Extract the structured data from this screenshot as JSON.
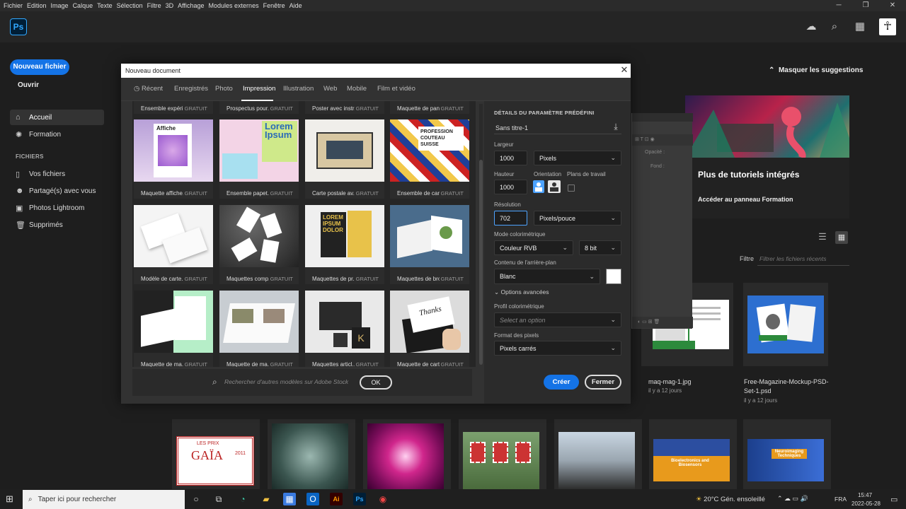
{
  "menubar": {
    "items": [
      "Fichier",
      "Edition",
      "Image",
      "Calque",
      "Texte",
      "Sélection",
      "Filtre",
      "3D",
      "Affichage",
      "Modules externes",
      "Fenêtre",
      "Aide"
    ]
  },
  "app": {
    "logo": "Ps"
  },
  "sidebar": {
    "new_file": "Nouveau fichier",
    "open": "Ouvrir",
    "home": "Accueil",
    "learn": "Formation",
    "files_title": "FICHIERS",
    "your_files": "Vos fichiers",
    "shared": "Partagé(s) avec vous",
    "lightroom": "Photos Lightroom",
    "deleted": "Supprimés"
  },
  "home": {
    "hide_suggestions": "Masquer les suggestions",
    "tutorial_title": "Plus de tutoriels intégrés",
    "tutorial_link": "Accéder au panneau Formation",
    "filter_label": "Filtre",
    "filter_placeholder": "Filtrer les fichiers récents",
    "recent": [
      {
        "name": "maq-mag-1.jpg",
        "date": "il y a 12 jours"
      },
      {
        "name": "Free-Magazine-Mockup-PSD-",
        "name2": "Set-1.psd",
        "date": "il y a 12 jours"
      }
    ],
    "bottom_gaia": {
      "line1": "LES PRIX",
      "line2": "GAÏA",
      "line3": "2011"
    },
    "bottom_bio": "Bioelectronics and Biosensors",
    "bottom_neuro": "Neuroimaging Techniques"
  },
  "dialog": {
    "title": "Nouveau document",
    "tabs": [
      "Récent",
      "Enregistrés",
      "Photo",
      "Impression",
      "Illustration",
      "Web",
      "Mobile",
      "Film et vidéo"
    ],
    "active_tab": "Impression",
    "free_label": "GRATUIT",
    "templates_top": [
      "Ensemble expéri...",
      "Prospectus pour...",
      "Poster avec instr...",
      "Maquette de pan..."
    ],
    "templates": [
      "Maquette affiche...",
      "Ensemble papet...",
      "Carte postale av...",
      "Ensemble de car...",
      "Modèle de carte...",
      "Maquettes comp...",
      "Maquettes de pr...",
      "Maquettes de bro...",
      "Maquette de ma...",
      "Maquette de ma...",
      "Maquettes articl...",
      "Maquette de cart..."
    ],
    "thumb_texts": {
      "affiche": "Affiche",
      "lorem": "Lorem Ipsum",
      "pro": "PROFESSION COUTEAU SUISSE",
      "lorem_dolor": "LOREM IPSUM DOLOR",
      "thanks": "Thanks"
    },
    "search_placeholder": "Rechercher d'autres modèles sur Adobe Stock",
    "ok": "OK",
    "preset": {
      "title": "DÉTAILS DU PARAMÈTRE PRÉDÉFINI",
      "name": "Sans titre-1",
      "width_label": "Largeur",
      "width_value": "1000",
      "width_unit": "Pixels",
      "height_label": "Hauteur",
      "height_value": "1000",
      "orientation_label": "Orientation",
      "artboards_label": "Plans de travail",
      "resolution_label": "Résolution",
      "resolution_value": "702",
      "resolution_unit": "Pixels/pouce",
      "color_mode_label": "Mode colorimétrique",
      "color_mode": "Couleur RVB",
      "bit_depth": "8 bit",
      "bg_label": "Contenu de l'arrière-plan",
      "bg_value": "Blanc",
      "advanced": "Options avancées",
      "profile_label": "Profil colorimétrique",
      "profile_placeholder": "Select an option",
      "pixel_label": "Format des pixels",
      "pixel_value": "Pixels carrés"
    },
    "create": "Créer",
    "close": "Fermer"
  },
  "panel_behind": {
    "opacity": "Opacité :",
    "fill": "Fond :"
  },
  "taskbar": {
    "search_placeholder": "Taper ici pour rechercher",
    "weather": "20°C  Gén. ensoleillé",
    "lang": "FRA",
    "time": "15:47",
    "date": "2022-05-28"
  },
  "colors": {
    "accent": "#1473e6",
    "ps_blue": "#31a8ff"
  }
}
